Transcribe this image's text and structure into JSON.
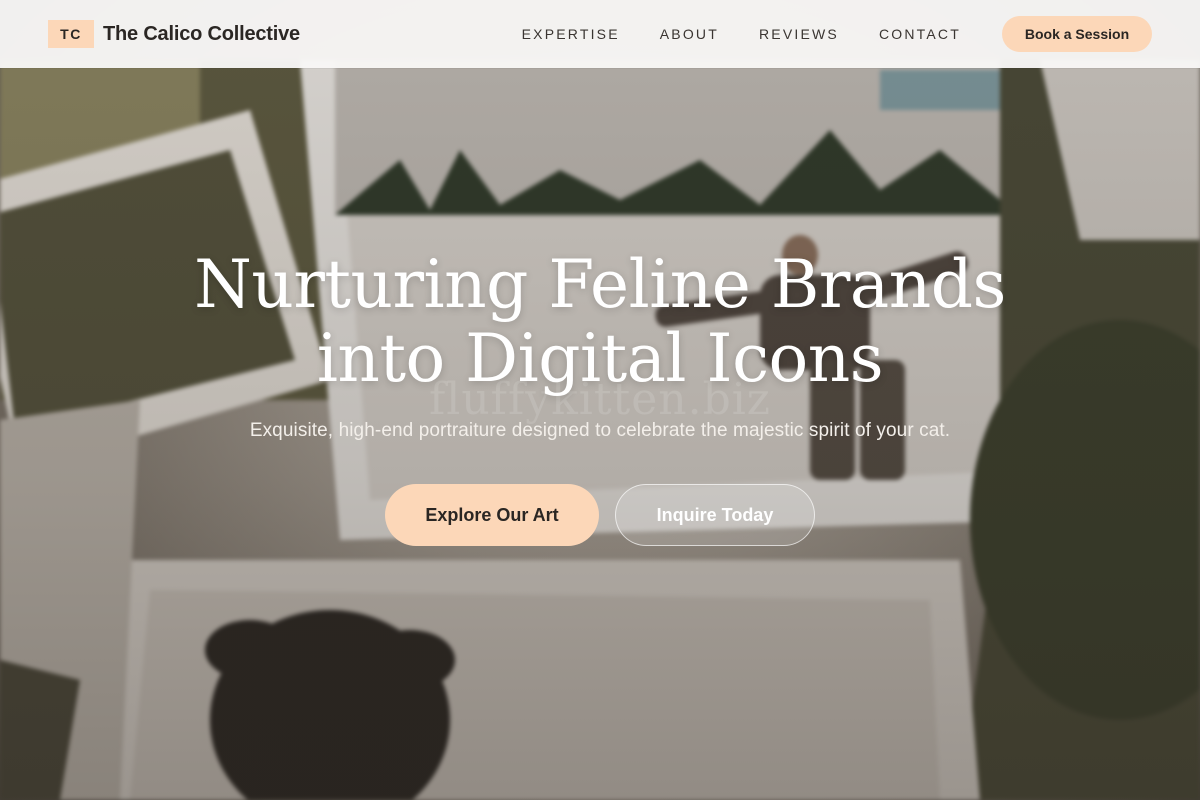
{
  "nav": {
    "logo_text": "TC",
    "brand_name": "The Calico Collective",
    "links": [
      {
        "label": "EXPERTISE"
      },
      {
        "label": "ABOUT"
      },
      {
        "label": "REVIEWS"
      },
      {
        "label": "CONTACT"
      }
    ],
    "cta_label": "Book a Session"
  },
  "hero": {
    "title_line1": "Nurturing Feline Brands",
    "title_line2": "into Digital Icons",
    "watermark": "fluffykitten.biz",
    "subtitle": "Exquisite, high-end portraiture designed to celebrate the majestic spirit of your cat.",
    "primary_button": "Explore Our Art",
    "secondary_button": "Inquire Today",
    "background_image": "blurred-photo-prints-collage"
  },
  "colors": {
    "accent": "#fcd7b8",
    "nav_background": "#f8f7f6",
    "text_dark": "#2b2724"
  }
}
